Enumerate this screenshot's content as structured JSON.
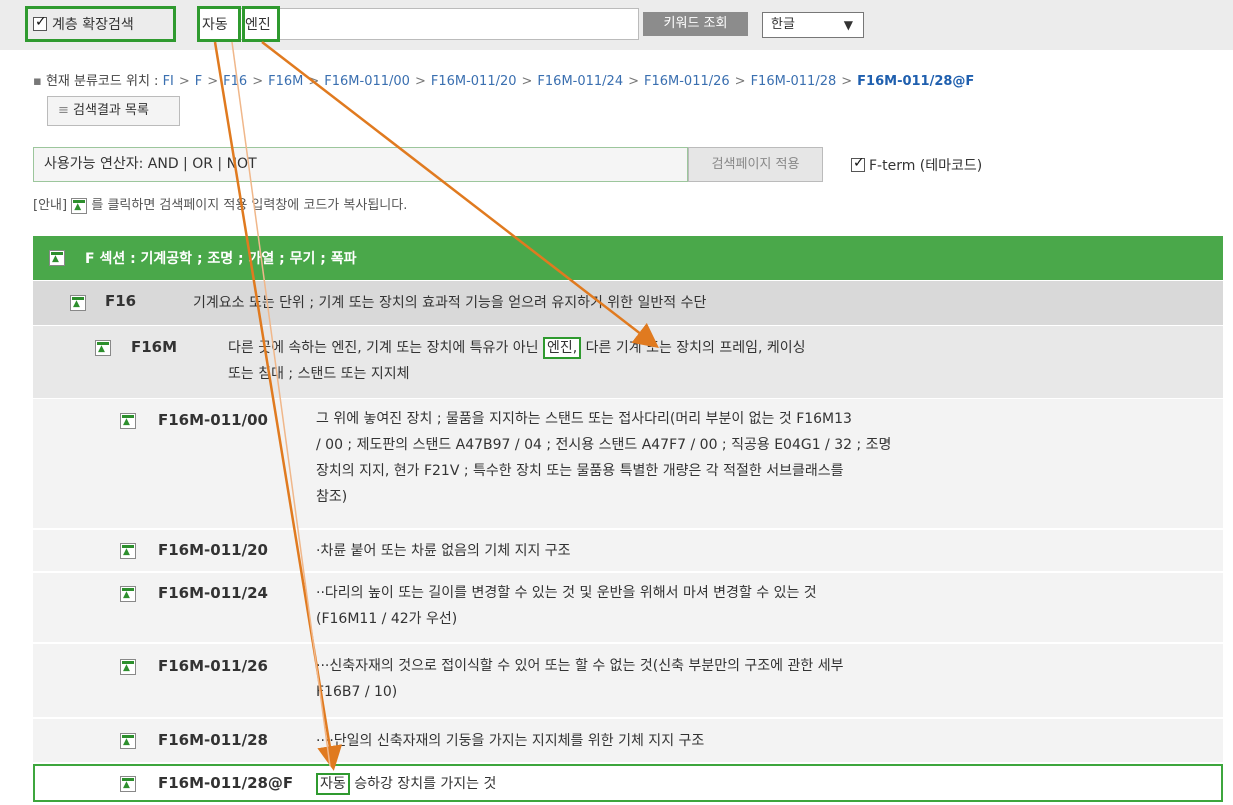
{
  "top_bar": {
    "hierarchy_checkbox_label": "계층 확장검색",
    "query_token_1": "자동",
    "query_token_2": "엔진",
    "keyword_button": "키워드 조회",
    "language_select": "한글"
  },
  "location": {
    "label": "현재 분류코드 위치 :",
    "crumbs": [
      "FI",
      "F",
      "F16",
      "F16M",
      "F16M-011/00",
      "F16M-011/20",
      "F16M-011/24",
      "F16M-011/26",
      "F16M-011/28",
      "F16M-011/28@F"
    ],
    "result_list_button": "검색결과 목록"
  },
  "operators": {
    "text": "사용가능 연산자: AND | OR | NOT",
    "apply_button": "검색페이지 적용",
    "fterm_label": "F-term (테마코드)"
  },
  "notice": {
    "prefix": "[안내]",
    "text": "를 클릭하면 검색페이지 적용 입력창에 코드가 복사됩니다."
  },
  "rows": {
    "section": "F 섹션 :  기계공학 ; 조명 ; 가열 ; 무기 ; 폭파",
    "f16_code": "F16",
    "f16_desc": "기계요소 또는 단위 ; 기계 또는 장치의 효과적 기능을 얻으려 유지하기 위한 일반적 수단",
    "f16m_code": "F16M",
    "f16m_desc_pre": "다른 곳에 속하는 엔진, 기계 또는 장치에 특유가 아닌 ",
    "f16m_desc_hl": "엔진,",
    "f16m_desc_post": " 다른 기계 또는 장치의 프레임, 케이싱",
    "f16m_desc_line2": "또는 침대 ; 스탠드 또는 지지체",
    "r00_code": "F16M-011/00",
    "r00_l1": "그 위에 놓여진 장치 ; 물품을 지지하는 스탠드 또는 접사다리(머리 부분이 없는 것 F16M13",
    "r00_l2": "/ 00 ; 제도판의 스탠드 A47B97 / 04 ; 전시용 스탠드 A47F7 / 00 ; 직공용 E04G1 / 32 ; 조명",
    "r00_l3": "장치의 지지, 현가 F21V ; 특수한 장치 또는 물품용 특별한 개량은 각 적절한 서브클래스를",
    "r00_l4": "참조)",
    "r20_code": "F16M-011/20",
    "r20_desc": "·차륜 붙어 또는 차륜 없음의 기체 지지 구조",
    "r24_code": "F16M-011/24",
    "r24_l1": "··다리의 높이 또는 길이를 변경할 수 있는 것 및 운반을 위해서 마셔 변경할 수 있는 것",
    "r24_l2": "(F16M11 / 42가 우선)",
    "r26_code": "F16M-011/26",
    "r26_l1": "···신축자재의 것으로 접이식할 수 있어 또는 할 수 없는 것(신축 부분만의 구조에 관한 세부",
    "r26_l2": "F16B7 / 10)",
    "r28_code": "F16M-011/28",
    "r28_desc": "····단일의 신축자재의 기둥을 가지는 지지체를 위한 기체 지지 구조",
    "rF_code": "F16M-011/28@F",
    "rF_hl": "자동",
    "rF_desc": "승하강 장치를 가지는 것"
  },
  "colors": {
    "accent_green": "#4aa84a",
    "highlight_green": "#2f9a2f",
    "arrow_orange": "#e07a1f",
    "link_blue": "#3a6fb0"
  }
}
